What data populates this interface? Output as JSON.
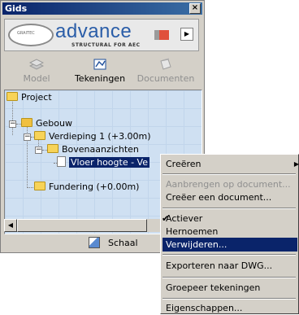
{
  "window": {
    "title": "Gids",
    "close_glyph": "×"
  },
  "logo": {
    "wordmark": "advance",
    "tagline": "STRUCTURAL FOR AEC",
    "badge": "GRAITEC"
  },
  "tabs": [
    {
      "label": "Model",
      "icon": "model-icon",
      "enabled": false
    },
    {
      "label": "Tekeningen",
      "icon": "drawings-icon",
      "enabled": true
    },
    {
      "label": "Documenten",
      "icon": "documents-icon",
      "enabled": false
    }
  ],
  "tree": {
    "project": "Project",
    "gebouw": "Gebouw",
    "verdieping": "Verdieping 1 (+3.00m)",
    "bovenaanzichten": "Bovenaanzichten",
    "vloer": "Vloer hoogte - Ve",
    "fundering": "Fundering (+0.00m)"
  },
  "expanders": {
    "minus": "−"
  },
  "footer": {
    "schaal_label": "Schaal"
  },
  "context_menu": {
    "items": [
      {
        "label": "Creëren",
        "enabled": true,
        "submenu": true
      },
      {
        "label": "Aanbrengen op document...",
        "enabled": false
      },
      {
        "label": "Creëer een document...",
        "enabled": true
      },
      {
        "label": "Actiever",
        "enabled": true,
        "checked": true
      },
      {
        "label": "Hernoemen",
        "enabled": true
      },
      {
        "label": "Verwijderen...",
        "enabled": true,
        "highlighted": true
      },
      {
        "label": "Exporteren naar DWG...",
        "enabled": true
      },
      {
        "label": "Groepeer tekeningen",
        "enabled": true
      },
      {
        "label": "Eigenschappen...",
        "enabled": true
      }
    ],
    "check_glyph": "✔",
    "submenu_glyph": "▶"
  },
  "colors": {
    "title_bar": "#0a246a",
    "highlight": "#0a246a",
    "tree_bg": "#cfe0f2",
    "logo_blue": "#2a5da8"
  }
}
